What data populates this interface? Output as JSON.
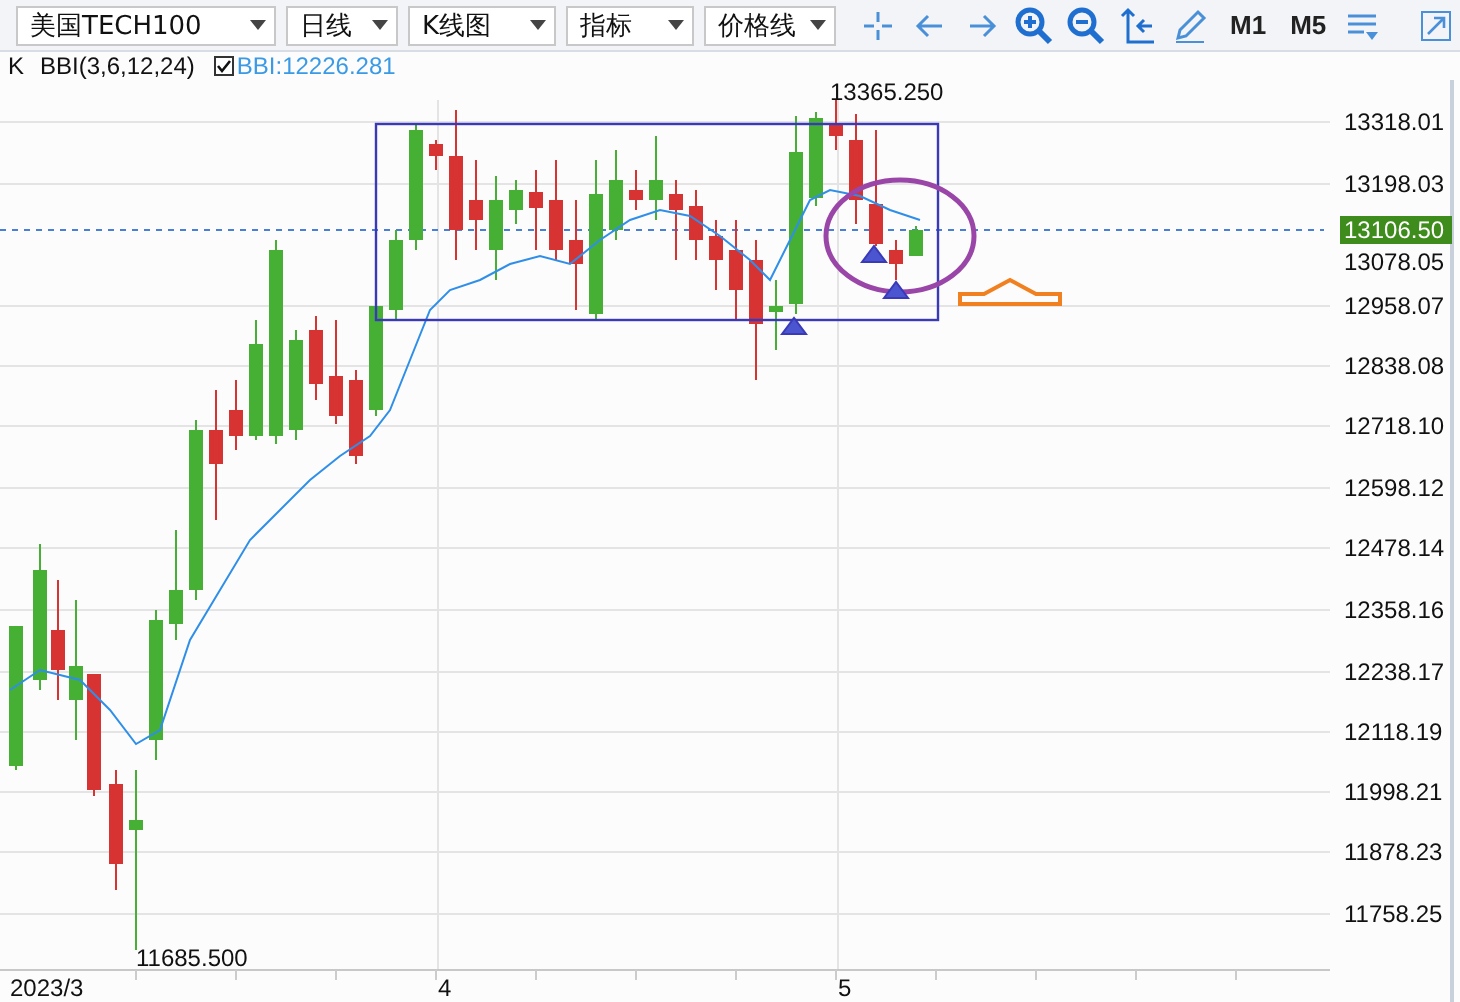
{
  "toolbar": {
    "dropdowns": [
      {
        "label": "美国TECH100"
      },
      {
        "label": "日线"
      },
      {
        "label": "K线图"
      },
      {
        "label": "指标"
      },
      {
        "label": "价格线"
      }
    ],
    "period_buttons": [
      "M1",
      "M5"
    ]
  },
  "legend": {
    "series_label": "K",
    "indicator": "BBI(3,6,12,24)",
    "checked": true,
    "value": "BBI:12226.281"
  },
  "chart": {
    "y_axis_labels": [
      "13318.01",
      "13198.03",
      "12958.07",
      "12838.08",
      "12718.10",
      "12598.12",
      "12478.14",
      "12358.16",
      "12238.17",
      "12118.19",
      "11998.21",
      "11878.23",
      "11758.25"
    ],
    "other_axis_label": "13078.05",
    "current_price": "13106.50",
    "high_label": "13365.250",
    "low_label": "11685.500",
    "x_axis_labels": [
      "2023/3",
      "4",
      "5"
    ]
  }
}
